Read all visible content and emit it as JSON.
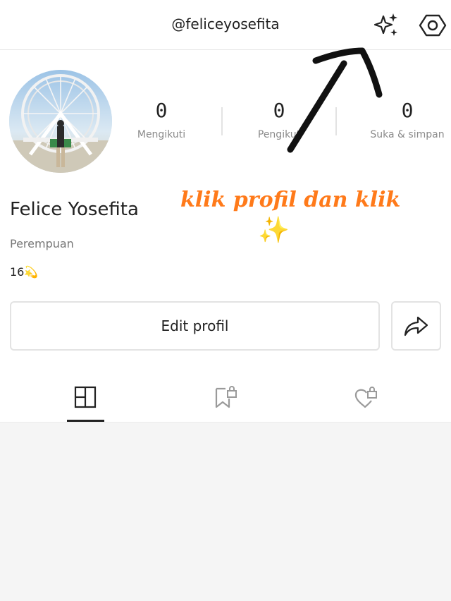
{
  "header": {
    "handle": "@feliceyosefita",
    "icons": [
      "sparkle-icon",
      "settings-hexagon-icon"
    ]
  },
  "profile": {
    "name": "Felice Yosefita",
    "gender": "Perempuan",
    "bio": "16💫"
  },
  "stats": [
    {
      "value": "0",
      "label": "Mengikuti"
    },
    {
      "value": "0",
      "label": "Pengikut"
    },
    {
      "value": "0",
      "label": "Suka & simpan"
    }
  ],
  "actions": {
    "edit_label": "Edit profil",
    "share_icon": "share-arrow-icon"
  },
  "tabs": [
    {
      "name": "posts-grid",
      "icon": "grid-icon",
      "active": true
    },
    {
      "name": "saved-locked",
      "icon": "bookmark-lock-icon",
      "active": false
    },
    {
      "name": "likes-locked",
      "icon": "heart-lock-icon",
      "active": false
    }
  ],
  "annotation": {
    "text": "klik profil dan klik",
    "emoji": "✨"
  },
  "colors": {
    "annotation_text": "#ff7a1a",
    "background": "#ffffff",
    "feed_background": "#f5f5f5"
  }
}
